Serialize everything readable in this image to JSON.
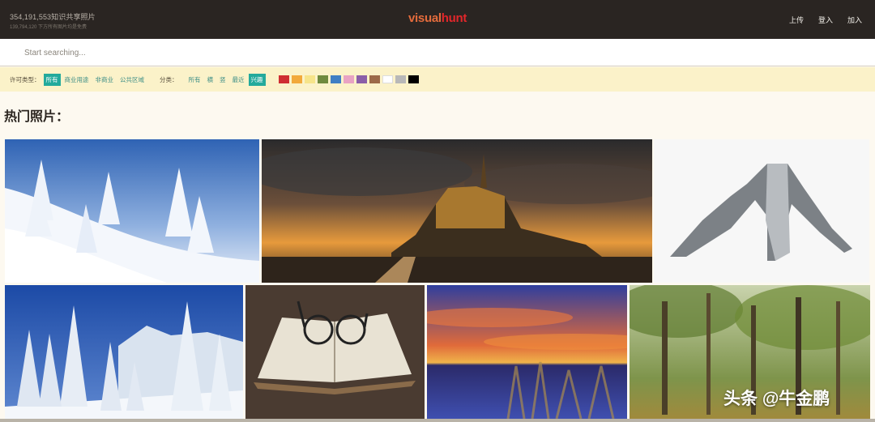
{
  "header": {
    "stats_count": "354,191,553知识共享照片",
    "stats_sub": "139,794,120 下方所有图片均是免费",
    "logo_part1": "visual",
    "logo_part2": "hunt",
    "nav": {
      "upload": "上传",
      "login": "登入",
      "join": "加入"
    }
  },
  "search": {
    "placeholder": "Start searching...",
    "value": ""
  },
  "filters": {
    "license_label": "许可类型：",
    "license_options": [
      "所有",
      "商业用途",
      "非商业",
      "公共区域"
    ],
    "category_label": "分类：",
    "category_options": [
      "所有",
      "横",
      "竖",
      "最近",
      "兴趣"
    ],
    "colors": [
      "#cf2e32",
      "#f2a93b",
      "#f6e48a",
      "#6f8a3e",
      "#3f7fc4",
      "#e9a3c3",
      "#8a5ea8",
      "#9c6a49",
      "#ffffff",
      "#b8b8b8",
      "#000000"
    ]
  },
  "section_title": "热门照片：",
  "photos": [
    {
      "alt": "snowy pine slope"
    },
    {
      "alt": "castle at sunset"
    },
    {
      "alt": "dancer pose"
    },
    {
      "alt": "snow forest mountain"
    },
    {
      "alt": "book with glasses"
    },
    {
      "alt": "lake sunset"
    },
    {
      "alt": "green forest"
    }
  ],
  "watermark": "头条 @牛金鹏"
}
